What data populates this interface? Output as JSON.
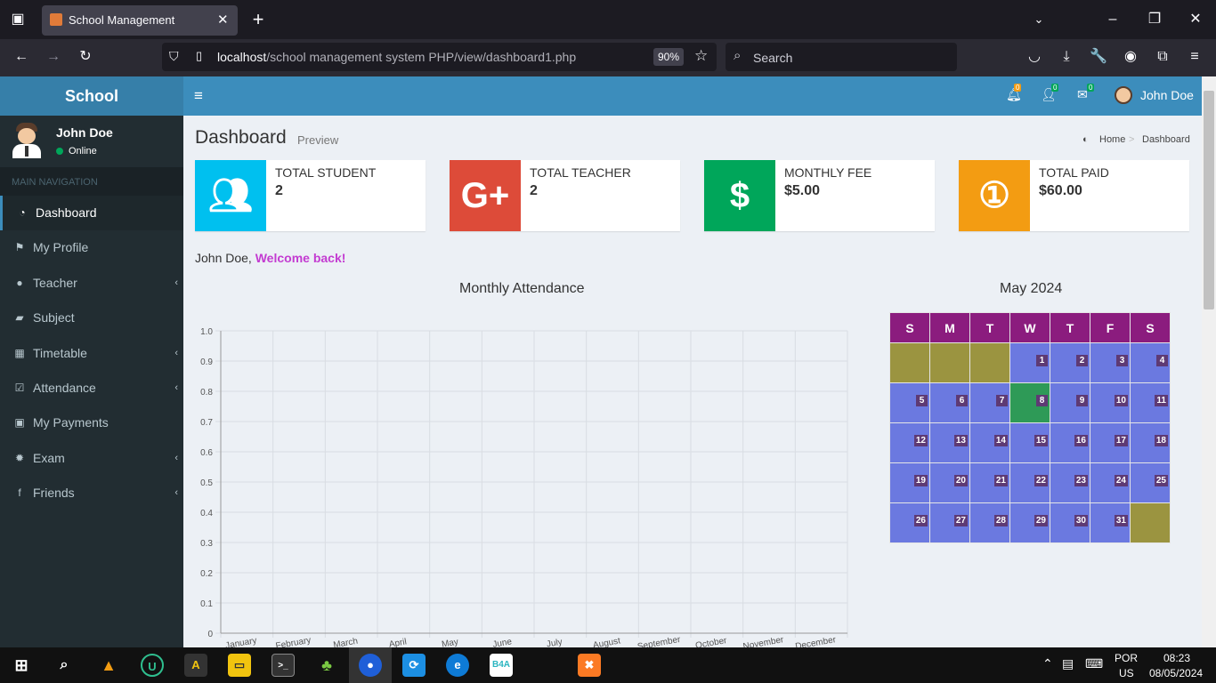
{
  "browser": {
    "tab_title": "School Management",
    "url_host": "localhost",
    "url_path": "/school management system PHP/view/dashboard1.php",
    "zoom": "90%",
    "search_placeholder": "Search"
  },
  "app": {
    "logo": "School",
    "topnav": {
      "notifications_count": "0",
      "friend_requests_count": "0",
      "messages_count": "0",
      "user_name": "John Doe"
    },
    "sidebar": {
      "user_name": "John Doe",
      "status": "Online",
      "section_header": "MAIN NAVIGATION",
      "items": [
        {
          "label": "Dashboard",
          "icon": "dashboard-icon",
          "has_children": false
        },
        {
          "label": "My Profile",
          "icon": "flag-icon",
          "has_children": false
        },
        {
          "label": "Teacher",
          "icon": "user-icon",
          "has_children": true
        },
        {
          "label": "Subject",
          "icon": "book-icon",
          "has_children": false
        },
        {
          "label": "Timetable",
          "icon": "calendar-plus-icon",
          "has_children": true
        },
        {
          "label": "Attendance",
          "icon": "calendar-check-icon",
          "has_children": true
        },
        {
          "label": "My Payments",
          "icon": "money-icon",
          "has_children": false
        },
        {
          "label": "Exam",
          "icon": "gear-icon",
          "has_children": true
        },
        {
          "label": "Friends",
          "icon": "facebook-icon",
          "has_children": true
        }
      ]
    },
    "page": {
      "title": "Dashboard",
      "subtitle": "Preview",
      "breadcrumb_home": "Home",
      "breadcrumb_current": "Dashboard",
      "welcome_name": "John Doe,",
      "welcome_text": "Welcome back!"
    },
    "info_boxes": [
      {
        "label": "TOTAL STUDENT",
        "value": "2",
        "color": "#00c0ef",
        "icon": "users-icon"
      },
      {
        "label": "TOTAL TEACHER",
        "value": "2",
        "color": "#dd4b39",
        "icon": "google-plus-icon"
      },
      {
        "label": "MONTHLY FEE",
        "value": "$5.00",
        "color": "#00a65a",
        "icon": "dollar-icon"
      },
      {
        "label": "TOTAL PAID",
        "value": "$60.00",
        "color": "#f39c12",
        "icon": "money-icon"
      }
    ],
    "calendar": {
      "title": "May 2024",
      "weekdays": [
        "S",
        "M",
        "T",
        "W",
        "T",
        "F",
        "S"
      ],
      "first_weekday_index": 3,
      "days_in_month": 31,
      "today": 8,
      "header_color": "#8b1c7e",
      "day_color": "#6b79e0",
      "today_color": "#2e9a57",
      "empty_color": "#9b9440"
    }
  },
  "chart_data": {
    "type": "line",
    "title": "Monthly Attendance",
    "categories": [
      "January",
      "February",
      "March",
      "April",
      "May",
      "June",
      "July",
      "August",
      "September",
      "October",
      "November",
      "December"
    ],
    "series": [],
    "ylim": [
      0,
      1.0
    ],
    "yticks": [
      "0",
      "0.1",
      "0.2",
      "0.3",
      "0.4",
      "0.5",
      "0.6",
      "0.7",
      "0.8",
      "0.9",
      "1.0"
    ],
    "grid": true
  },
  "taskbar": {
    "language": "POR",
    "region": "US",
    "time": "08:23",
    "date": "08/05/2024"
  }
}
